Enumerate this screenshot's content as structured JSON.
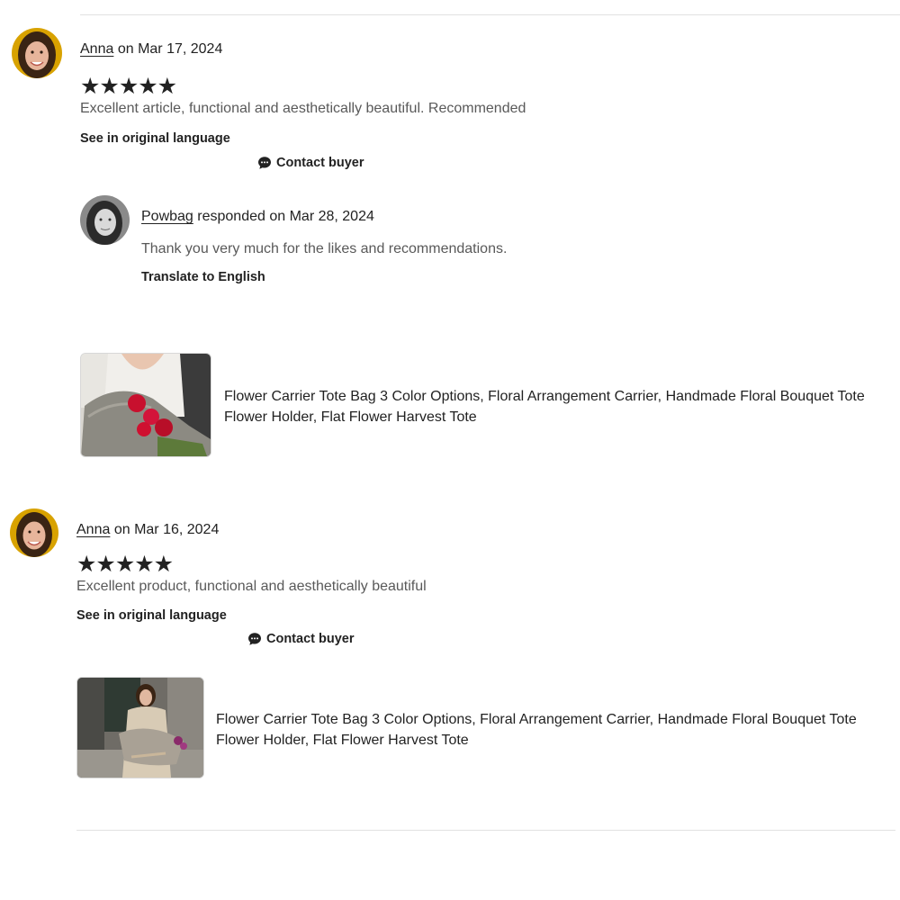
{
  "reviews": [
    {
      "reviewer": "Anna",
      "date_text": "on Mar 17, 2024",
      "stars": "★★★★★",
      "text": "Excellent article, functional and aesthetically beautiful. Recommended",
      "see_original": "See in original language",
      "contact": "Contact buyer",
      "response": {
        "seller": "Powbag",
        "date_text": "responded on Mar 28, 2024",
        "text": "Thank you very much for the likes and recommendations.",
        "translate": "Translate to English"
      },
      "product_title": "Flower Carrier Tote Bag 3 Color Options, Floral Arrangement Carrier, Handmade Floral Bouquet Tote Flower Holder, Flat Flower Harvest Tote"
    },
    {
      "reviewer": "Anna",
      "date_text": "on Mar 16, 2024",
      "stars": "★★★★★",
      "text": "Excellent product, functional and aesthetically beautiful",
      "see_original": "See in original language",
      "contact": "Contact buyer",
      "product_title": "Flower Carrier Tote Bag 3 Color Options, Floral Arrangement Carrier, Handmade Floral Bouquet Tote Flower Holder, Flat Flower Harvest Tote"
    }
  ],
  "ratings": [
    5,
    5
  ],
  "icons": {
    "contact": "chat-bubble-icon"
  },
  "colors": {
    "text": "#222222",
    "muted": "#595959",
    "divider": "#e1e1e1"
  }
}
